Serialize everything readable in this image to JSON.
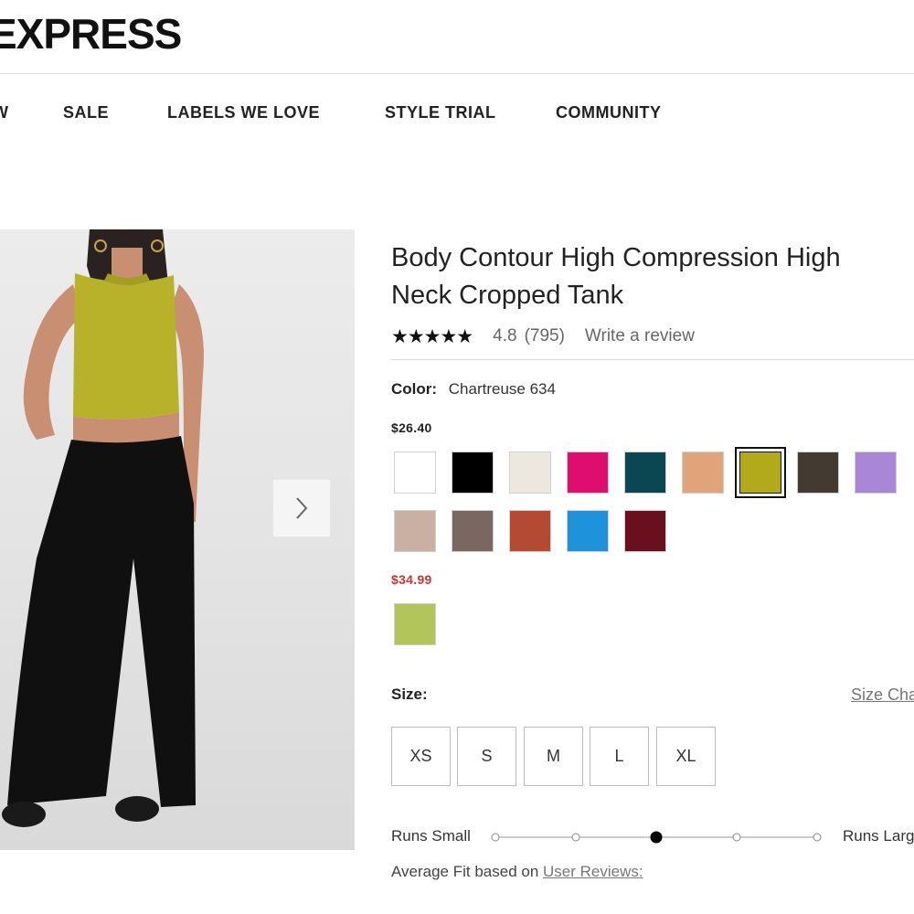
{
  "brand": {
    "logo_text": "EXPRESS"
  },
  "nav": {
    "items": [
      {
        "label": "W"
      },
      {
        "label": "SALE"
      },
      {
        "label": "LABELS WE LOVE"
      },
      {
        "label": "STYLE TRIAL"
      },
      {
        "label": "COMMUNITY"
      }
    ]
  },
  "gallery": {
    "next_icon": "chevron-right-icon"
  },
  "product": {
    "title": "Body Contour High Compression High Neck Cropped Tank",
    "rating": {
      "stars_display": "★★★★★",
      "value": "4.8",
      "count": "(795)",
      "write_review": "Write a review"
    },
    "color": {
      "label": "Color:",
      "selected": "Chartreuse 634"
    },
    "price_regular": "$26.40",
    "price_sale": "$34.99",
    "sale_color": "#d0342c",
    "swatches_regular": [
      {
        "name": "white",
        "hex": "#ffffff"
      },
      {
        "name": "black",
        "hex": "#000000"
      },
      {
        "name": "ivory",
        "hex": "#ece8df"
      },
      {
        "name": "magenta",
        "hex": "#e00d70"
      },
      {
        "name": "teal",
        "hex": "#0b4752"
      },
      {
        "name": "tan",
        "hex": "#e1a47a"
      },
      {
        "name": "chartreuse",
        "hex": "#b2aa1b",
        "selected": true
      },
      {
        "name": "dark-brown",
        "hex": "#433a32"
      },
      {
        "name": "lavender",
        "hex": "#a987d6"
      },
      {
        "name": "beige",
        "hex": "#c9b0a2"
      },
      {
        "name": "taupe",
        "hex": "#7b6762"
      },
      {
        "name": "rust",
        "hex": "#b44a33"
      },
      {
        "name": "blue",
        "hex": "#1e93db"
      },
      {
        "name": "burgundy",
        "hex": "#6a0f1d"
      }
    ],
    "swatches_sale": [
      {
        "name": "lime",
        "hex": "#b2c55b"
      }
    ],
    "size": {
      "label": "Size:",
      "chart_link": "Size Cha",
      "options": [
        "XS",
        "S",
        "M",
        "L",
        "XL"
      ]
    },
    "fit": {
      "left_label": "Runs Small",
      "right_label": "Runs Larg",
      "steps": 5,
      "selected_step": 3,
      "average_text": "Average Fit based on",
      "reviews_link": "User Reviews:"
    }
  }
}
